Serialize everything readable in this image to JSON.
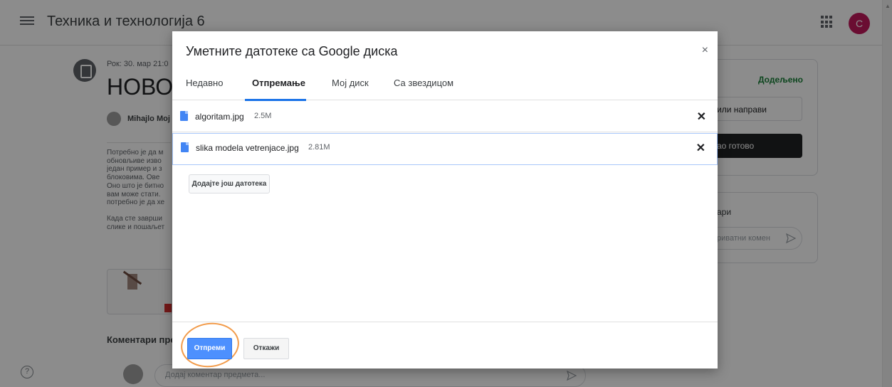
{
  "page": {
    "class_title": "Техника и технологија 6",
    "avatar_letter": "C",
    "assignment": {
      "due": "Рок: 30. мар 21:0",
      "title": "НОВО!",
      "author": "Mihajlo Moj",
      "body_lines_1": [
        "Потребно је да м",
        "обновљиве изво",
        "један пример и з",
        "блоковима. Ове",
        "Оно што је битно",
        "вам може стати.",
        "потребно је да хе"
      ],
      "body_lines_2": [
        "Када сте заврши",
        "слике и пошаљет"
      ],
      "comments_label": "Коментари пре",
      "comment_placeholder": "Додај коментар предмета..."
    },
    "side": {
      "assigned_status": "Додељено",
      "create_label": "или направи",
      "done_label": "ао готово",
      "private_label": "ари",
      "private_placeholder": "риватни комен"
    },
    "help_glyph": "?"
  },
  "modal": {
    "title": "Уметните датотеке са Google диска",
    "close_glyph": "×",
    "tabs": [
      {
        "label": "Недавно",
        "active": false
      },
      {
        "label": "Отпремање",
        "active": true
      },
      {
        "label": "Мој диск",
        "active": false
      },
      {
        "label": "Са звездицом",
        "active": false
      }
    ],
    "files": [
      {
        "name": "algoritam.jpg",
        "size": "2.5M",
        "icon": "doc-icon",
        "selected": false
      },
      {
        "name": "slika modela vetrenjace.jpg",
        "size": "2.81M",
        "icon": "doc-icon",
        "selected": true
      }
    ],
    "remove_glyph": "✕",
    "add_more_label": "Додајте још датотека",
    "upload_label": "Отпреми",
    "cancel_label": "Откажи"
  },
  "colors": {
    "accent": "#1a73e8",
    "upload_button": "#4d90fe",
    "highlight": "#f29b4a",
    "assigned": "#188038"
  }
}
